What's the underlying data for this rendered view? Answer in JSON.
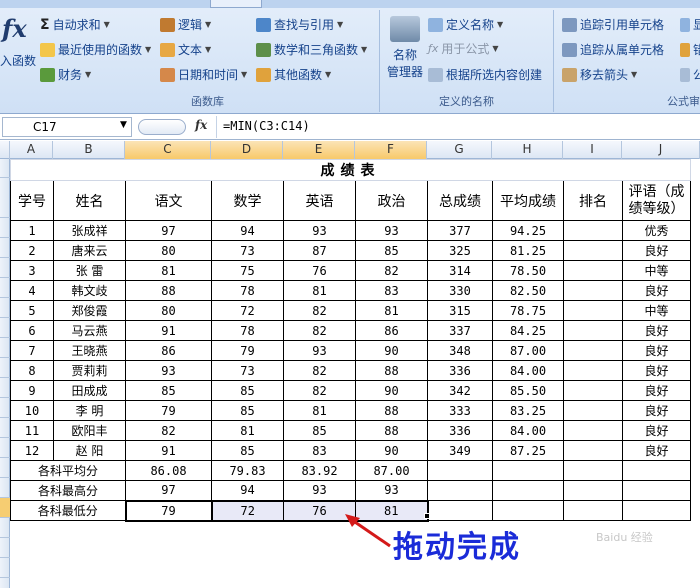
{
  "ribbon": {
    "insert_function_top": "fx",
    "insert_function": "入函数",
    "groups": {
      "function_library": {
        "title": "函数库",
        "autosum": "自动求和",
        "recent": "最近使用的函数",
        "financial": "财务",
        "logical": "逻辑",
        "text": "文本",
        "datetime": "日期和时间",
        "lookup": "查找与引用",
        "math": "数学和三角函数",
        "more": "其他函数"
      },
      "defined_names": {
        "title": "定义的名称",
        "name_manager_1": "名称",
        "name_manager_2": "管理器",
        "define_name": "定义名称",
        "use_in_formula": "用于公式",
        "create_from_selection": "根据所选内容创建"
      },
      "formula_auditing": {
        "title": "公式审",
        "trace_precedents": "追踪引用单元格",
        "trace_dependents": "追踪从属单元格",
        "remove_arrows": "移去箭头",
        "extra_1": "显",
        "extra_2": "错",
        "extra_3": "公"
      }
    }
  },
  "formula_bar": {
    "name_box": "C17",
    "fx": "fx",
    "formula": "=MIN(C3:C14)"
  },
  "columns": [
    "A",
    "B",
    "C",
    "D",
    "E",
    "F",
    "G",
    "H",
    "I",
    "J"
  ],
  "sheet": {
    "title": "成绩表",
    "headers": [
      "学号",
      "姓名",
      "语文",
      "数学",
      "英语",
      "政治",
      "总成绩",
      "平均成绩",
      "排名",
      "评语（成绩等级）"
    ],
    "rows": [
      [
        "1",
        "张成祥",
        "97",
        "94",
        "93",
        "93",
        "377",
        "94.25",
        "",
        "优秀"
      ],
      [
        "2",
        "唐来云",
        "80",
        "73",
        "87",
        "85",
        "325",
        "81.25",
        "",
        "良好"
      ],
      [
        "3",
        "张  雷",
        "81",
        "75",
        "76",
        "82",
        "314",
        "78.50",
        "",
        "中等"
      ],
      [
        "4",
        "韩文歧",
        "88",
        "78",
        "81",
        "83",
        "330",
        "82.50",
        "",
        "良好"
      ],
      [
        "5",
        "郑俊霞",
        "80",
        "72",
        "82",
        "81",
        "315",
        "78.75",
        "",
        "中等"
      ],
      [
        "6",
        "马云燕",
        "91",
        "78",
        "82",
        "86",
        "337",
        "84.25",
        "",
        "良好"
      ],
      [
        "7",
        "王晓燕",
        "86",
        "79",
        "93",
        "90",
        "348",
        "87.00",
        "",
        "良好"
      ],
      [
        "8",
        "贾莉莉",
        "93",
        "73",
        "82",
        "88",
        "336",
        "84.00",
        "",
        "良好"
      ],
      [
        "9",
        "田成成",
        "85",
        "85",
        "82",
        "90",
        "342",
        "85.50",
        "",
        "良好"
      ],
      [
        "10",
        "李  明",
        "79",
        "85",
        "81",
        "88",
        "333",
        "83.25",
        "",
        "良好"
      ],
      [
        "11",
        "欧阳丰",
        "82",
        "81",
        "85",
        "88",
        "336",
        "84.00",
        "",
        "良好"
      ],
      [
        "12",
        "赵  阳",
        "91",
        "85",
        "83",
        "90",
        "349",
        "87.25",
        "",
        "良好"
      ]
    ],
    "summary": [
      {
        "label": "各科平均分",
        "values": [
          "86.08",
          "79.83",
          "83.92",
          "87.00"
        ]
      },
      {
        "label": "各科最高分",
        "values": [
          "97",
          "94",
          "93",
          "93"
        ]
      },
      {
        "label": "各科最低分",
        "values": [
          "79",
          "72",
          "76",
          "81"
        ]
      }
    ]
  },
  "annotation": "拖动完成",
  "watermark": "Baidu 经验",
  "colors": {
    "annotation": "#1a2bd8",
    "selection": "#e8e9f7",
    "header_highlight": "#f8c96a"
  }
}
